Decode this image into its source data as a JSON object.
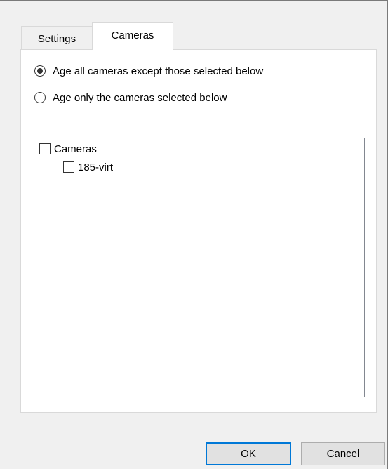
{
  "tabs": [
    {
      "label": "Settings",
      "active": false
    },
    {
      "label": "Cameras",
      "active": true
    }
  ],
  "options": {
    "all_except": {
      "label": "Age all cameras except those selected below",
      "checked": true
    },
    "only_selected": {
      "label": "Age only the cameras selected below",
      "checked": false
    }
  },
  "tree": {
    "root": {
      "label": "Cameras",
      "checked": false
    },
    "children": [
      {
        "label": "185-virt",
        "checked": false
      }
    ]
  },
  "buttons": {
    "ok": "OK",
    "cancel": "Cancel"
  },
  "colors": {
    "accent": "#0078d7"
  }
}
